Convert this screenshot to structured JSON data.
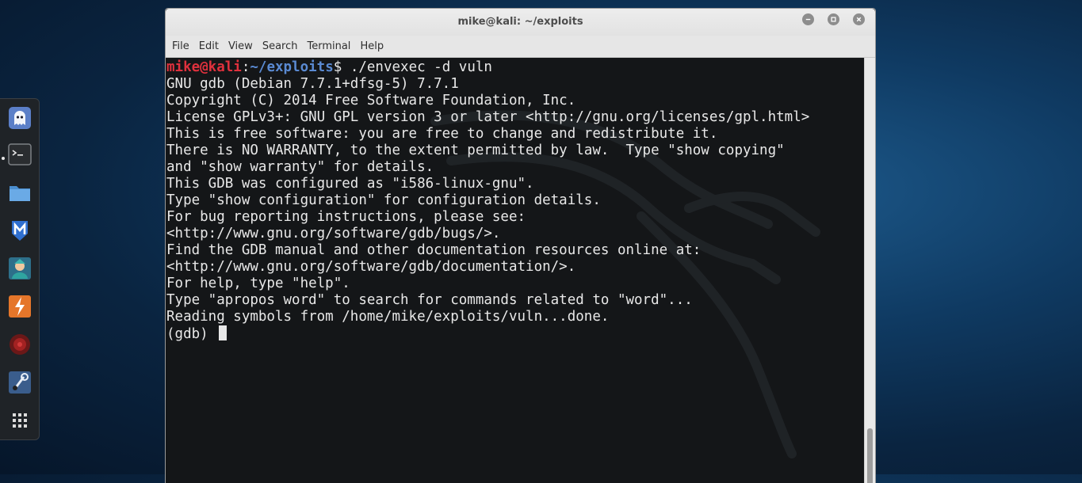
{
  "window": {
    "title": "mike@kali: ~/exploits"
  },
  "menu": [
    "File",
    "Edit",
    "View",
    "Search",
    "Terminal",
    "Help"
  ],
  "dock": {
    "items": [
      {
        "name": "dock-item-ghost",
        "icon": "ghost-icon"
      },
      {
        "name": "dock-item-terminal",
        "icon": "terminal-icon",
        "active": true
      },
      {
        "name": "dock-item-files",
        "icon": "folder-icon"
      },
      {
        "name": "dock-item-metasploit",
        "icon": "metasploit-icon"
      },
      {
        "name": "dock-item-armitage",
        "icon": "avatar-icon"
      },
      {
        "name": "dock-item-burp",
        "icon": "burp-icon"
      },
      {
        "name": "dock-item-radare",
        "icon": "red-circle-icon"
      },
      {
        "name": "dock-item-tool",
        "icon": "tool-icon"
      },
      {
        "name": "dock-item-show-apps",
        "icon": "grid-icon"
      }
    ]
  },
  "terminal": {
    "prompt_user": "mike@kali",
    "prompt_sep": ":",
    "prompt_path": "~/exploits",
    "prompt_dollar": "$ ",
    "command": "./envexec -d vuln",
    "output": [
      "GNU gdb (Debian 7.7.1+dfsg-5) 7.7.1",
      "Copyright (C) 2014 Free Software Foundation, Inc.",
      "License GPLv3+: GNU GPL version 3 or later <http://gnu.org/licenses/gpl.html>",
      "This is free software: you are free to change and redistribute it.",
      "There is NO WARRANTY, to the extent permitted by law.  Type \"show copying\"",
      "and \"show warranty\" for details.",
      "This GDB was configured as \"i586-linux-gnu\".",
      "Type \"show configuration\" for configuration details.",
      "For bug reporting instructions, please see:",
      "<http://www.gnu.org/software/gdb/bugs/>.",
      "Find the GDB manual and other documentation resources online at:",
      "<http://www.gnu.org/software/gdb/documentation/>.",
      "For help, type \"help\".",
      "Type \"apropos word\" to search for commands related to \"word\"...",
      "Reading symbols from /home/mike/exploits/vuln...done."
    ],
    "gdb_prompt": "(gdb) "
  },
  "colors": {
    "prompt_user": "#e0313d",
    "prompt_path": "#5a8ad2",
    "terminal_bg": "#141618"
  }
}
